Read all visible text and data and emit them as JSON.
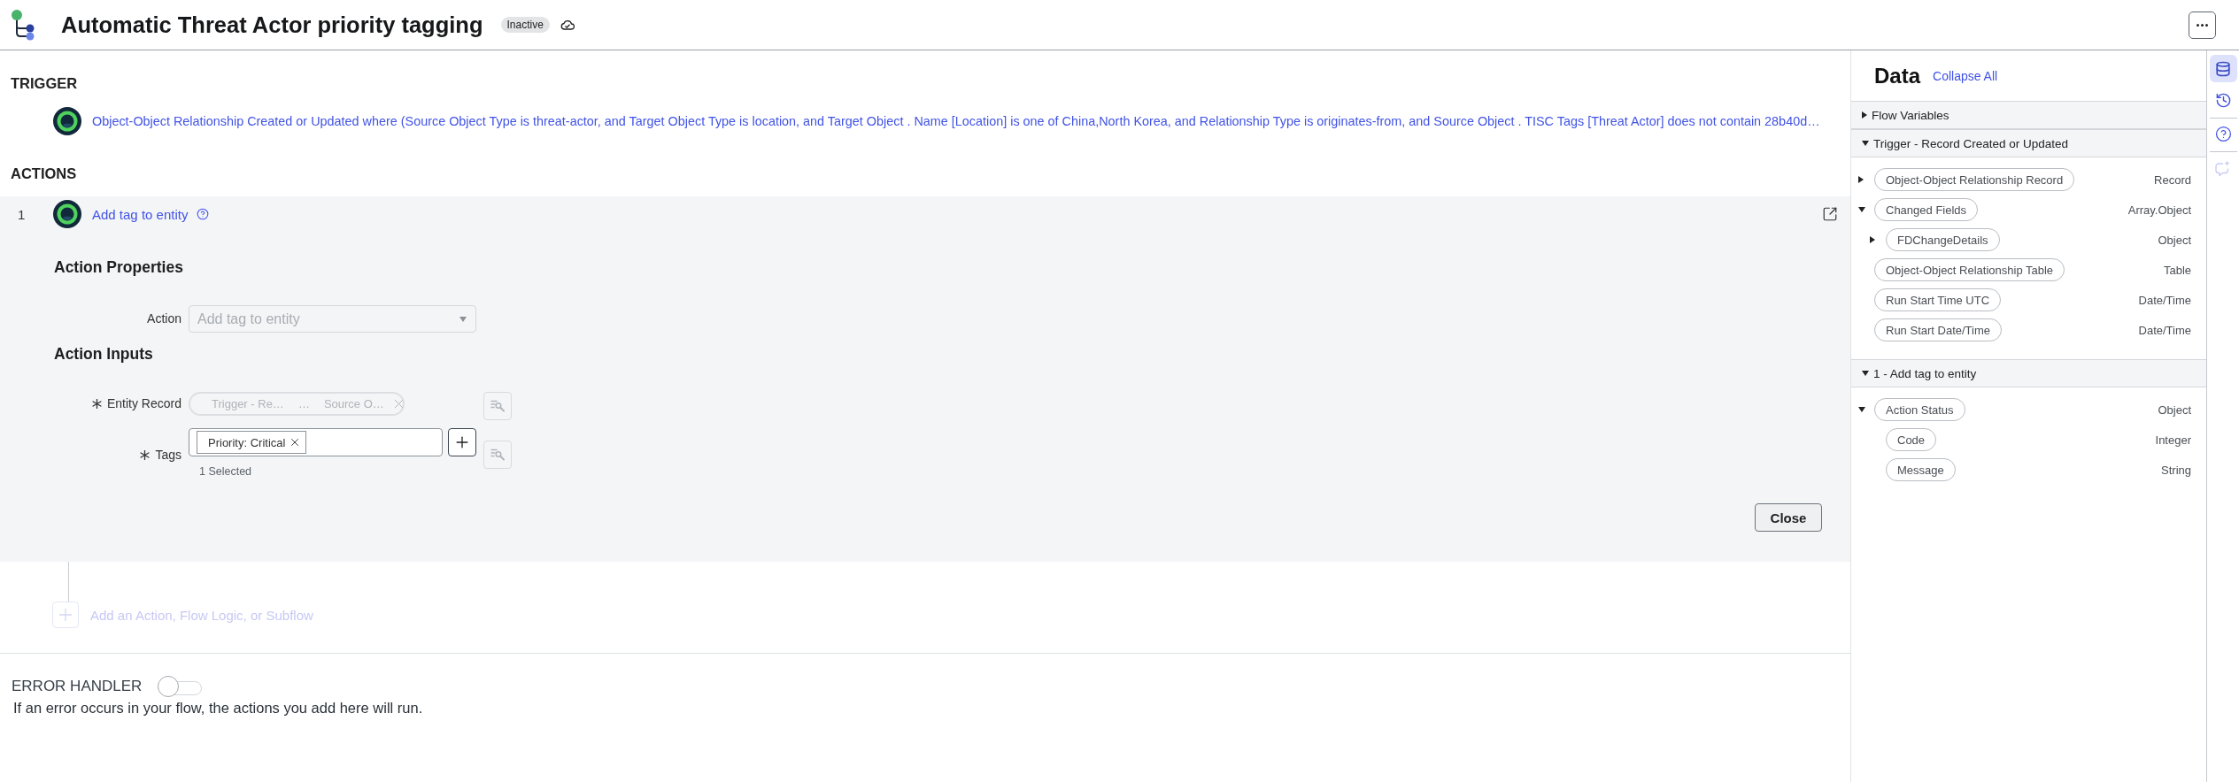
{
  "header": {
    "title": "Automatic Threat Actor priority tagging",
    "status": "Inactive"
  },
  "trigger": {
    "heading": "TRIGGER",
    "description": "Object-Object Relationship Created or Updated where (Source Object Type is threat-actor, and Target Object Type is location, and Target Object . Name [Location] is one of China,North Korea, and Relationship Type is originates-from, and Source Object . TISC Tags [Threat Actor] does not contain 28b40d…"
  },
  "actions": {
    "heading": "ACTIONS",
    "items": [
      {
        "number": "1",
        "name": "Add tag to entity",
        "properties_heading": "Action Properties",
        "action_field": {
          "label": "Action",
          "value": "Add tag to entity",
          "disabled": true
        },
        "inputs_heading": "Action Inputs",
        "inputs": [
          {
            "kind": "data_pill",
            "label": "Entity Record",
            "required": true,
            "disabled": true,
            "path": [
              "Trigger - Re…",
              "…",
              "Source O…"
            ]
          },
          {
            "kind": "tags",
            "label": "Tags",
            "required": true,
            "tags": [
              "Priority: Critical"
            ],
            "count": "1 Selected"
          }
        ],
        "close_button": "Close"
      }
    ],
    "add_step": {
      "label": "Add an Action, Flow Logic, or Subflow",
      "disabled": true
    }
  },
  "error_handler": {
    "label": "ERROR HANDLER",
    "on": false,
    "description": "If an error occurs in your flow, the actions you add here will run."
  },
  "data_panel": {
    "title": "Data",
    "collapse_all": "Collapse All",
    "sections": [
      {
        "title": "Flow Variables",
        "expanded": false
      },
      {
        "title": "Trigger - Record Created or Updated",
        "expanded": true,
        "items": [
          {
            "name": "Object-Object Relationship Record",
            "type": "Record",
            "expanded": false
          },
          {
            "name": "Changed Fields",
            "type": "Array.Object",
            "expanded": true,
            "children": [
              {
                "name": "FDChangeDetails",
                "type": "Object",
                "expanded": false
              }
            ]
          },
          {
            "name": "Object-Object Relationship Table",
            "type": "Table"
          },
          {
            "name": "Run Start Time UTC",
            "type": "Date/Time"
          },
          {
            "name": "Run Start Date/Time",
            "type": "Date/Time"
          }
        ]
      },
      {
        "title": "1 - Add tag to entity",
        "expanded": true,
        "items": [
          {
            "name": "Action Status",
            "type": "Object",
            "expanded": true,
            "children": [
              {
                "name": "Code",
                "type": "Integer"
              },
              {
                "name": "Message",
                "type": "String"
              }
            ]
          }
        ]
      }
    ]
  },
  "rail": [
    {
      "tools": [
        {
          "kind": "data",
          "selected": true,
          "disabled": false
        },
        {
          "kind": "history",
          "selected": false,
          "disabled": false
        }
      ]
    },
    {
      "tools": [
        {
          "kind": "help",
          "selected": false,
          "disabled": false
        }
      ]
    },
    {
      "tools": [
        {
          "kind": "assistant",
          "selected": false,
          "disabled": true
        }
      ]
    }
  ]
}
